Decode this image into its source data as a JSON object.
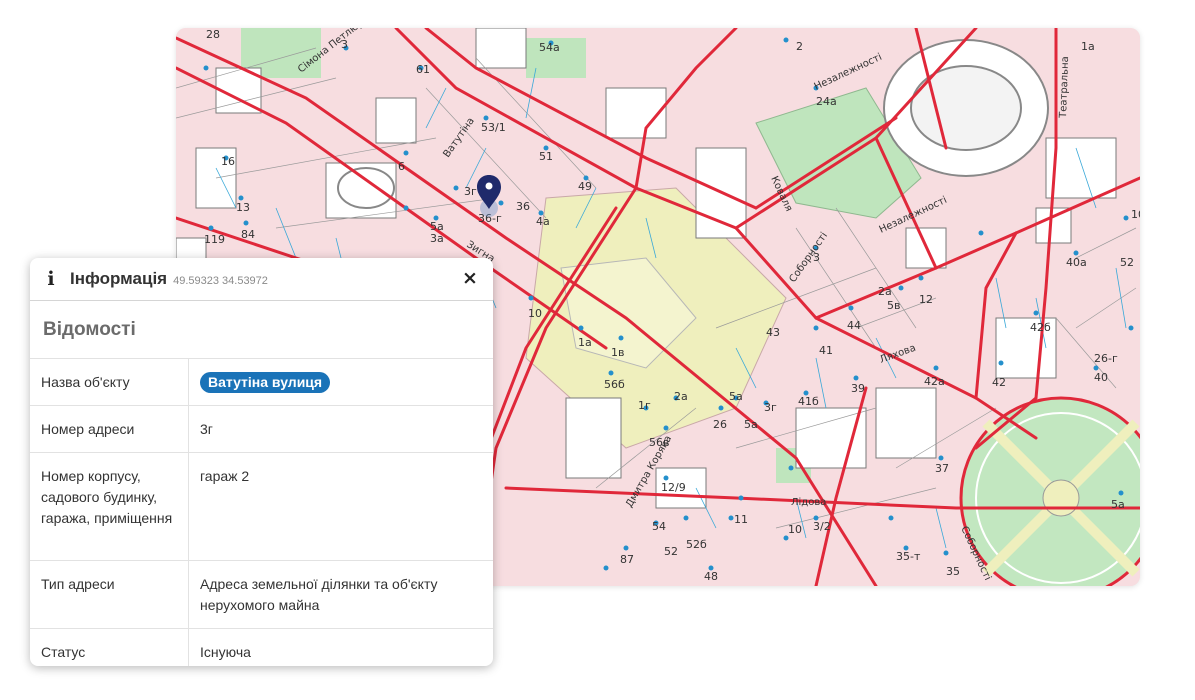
{
  "map": {
    "streets": [
      "Сімона Петлюри",
      "Незалежності",
      "Ватутіна",
      "Зигна",
      "Соборності",
      "Коваля",
      "Незалежності",
      "Театральна",
      "Ляхова",
      "Дмитра Коряка",
      "Лідова",
      "Соборності"
    ],
    "house_numbers": [
      "28",
      "3",
      "54а",
      "2",
      "1а",
      "61",
      "24а",
      "53/1",
      "51",
      "6",
      "49",
      "36",
      "16",
      "3г",
      "36-г",
      "13",
      "5а",
      "84",
      "3а",
      "4а",
      "119",
      "10",
      "3",
      "12",
      "40а",
      "44",
      "5в",
      "2а",
      "42б",
      "52",
      "43",
      "41",
      "1в",
      "1а",
      "26-г",
      "56б",
      "39",
      "42а",
      "42",
      "40",
      "5а",
      "3г",
      "41б",
      "2а",
      "1г",
      "56в",
      "26",
      "5а",
      "37",
      "12/9",
      "11",
      "10",
      "87",
      "54",
      "52б",
      "52",
      "3/2",
      "35-т",
      "48",
      "35",
      "5а",
      "10"
    ],
    "marker_icon": "map-pin-icon"
  },
  "panel": {
    "info_icon": "info-icon",
    "title": "Інформація",
    "coords": "49.59323 34.53972",
    "close_label": "×",
    "section_title": "Відомості",
    "rows": [
      {
        "key": "Назва об'єкту",
        "value": "Ватутіна вулиця"
      },
      {
        "key": "Номер адреси",
        "value": "3г"
      },
      {
        "key": "Номер корпусу, садового будинку, гаража, приміщення",
        "value": "гараж 2"
      },
      {
        "key": "Тип адреси",
        "value": "Адреса земельної ділянки та об'єкту нерухомого майна"
      },
      {
        "key": "Статус",
        "value": "Існуюча"
      }
    ]
  },
  "colors": {
    "badge": "#1a73b8",
    "marker": "#1f2a6b",
    "roads": "#e0283a",
    "parks": "#bde6bd",
    "yellow_zone": "#eeeeb8"
  }
}
